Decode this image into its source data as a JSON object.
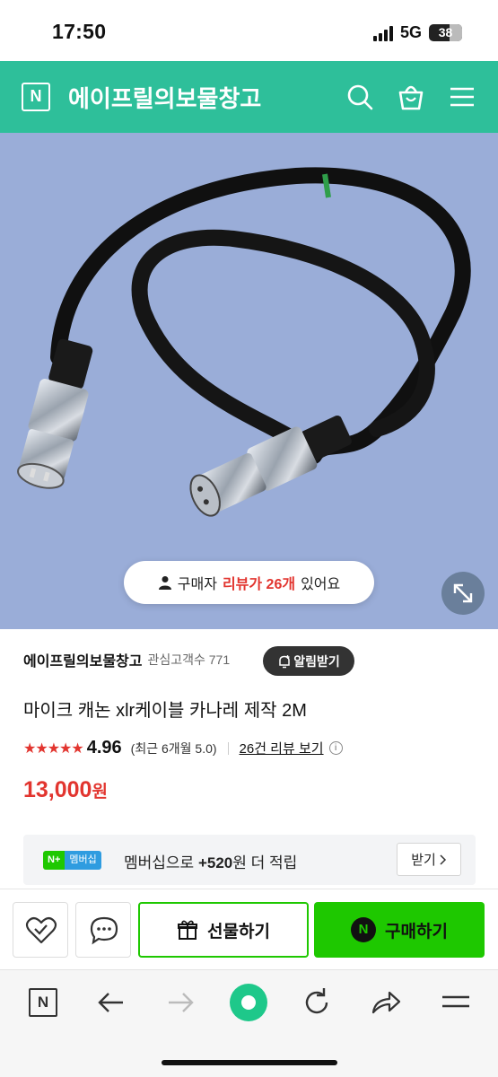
{
  "status": {
    "time": "17:50",
    "network": "5G",
    "battery": "38"
  },
  "header": {
    "logo": "N",
    "title": "에이프릴의보물창고"
  },
  "review_pill": {
    "prefix": "구매자 ",
    "highlight": "리뷰가 26개",
    "suffix": " 있어요"
  },
  "store": {
    "name": "에이프릴의보물창고",
    "followers": "관심고객수 771",
    "alarm_label": "알림받기"
  },
  "product": {
    "name": "마이크 캐논 xlr케이블 카나레 제작 2M",
    "stars": "★★★★★",
    "rating": "4.96",
    "recent_rating": "(최근 6개월 5.0)",
    "review_link": "26건 리뷰 보기",
    "price": "13,000",
    "price_unit": "원"
  },
  "membership": {
    "badge_n": "N+",
    "badge_text": "멤버십",
    "text_pre": "멤버십으로 ",
    "points": "+520",
    "text_post": "원 더 적립",
    "button": "받기"
  },
  "actions": {
    "gift": "선물하기",
    "buy": "구매하기",
    "buy_logo": "N"
  },
  "browser": {
    "logo": "N"
  },
  "colors": {
    "brand": "#2ebf9a",
    "naver_green": "#1ec800",
    "price_red": "#e2352f"
  }
}
